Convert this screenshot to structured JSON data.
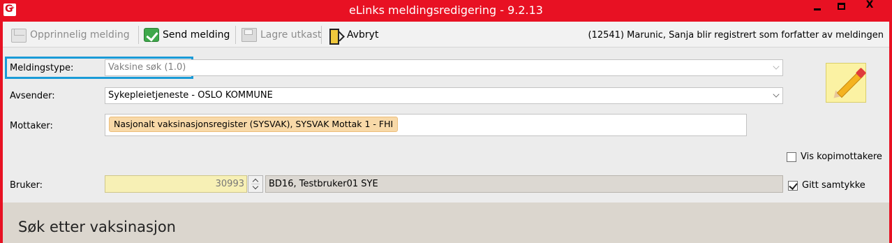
{
  "window": {
    "title": "eLinks meldingsredigering - 9.2.13",
    "app_icon_letter": "G",
    "app_icon_sup": "+",
    "close_glyph": "X"
  },
  "toolbar": {
    "original_label": "Opprinnelig melding",
    "send_label": "Send melding",
    "save_draft_label": "Lagre utkast",
    "cancel_label": "Avbryt",
    "info_text": "(12541) Marunic, Sanja blir registrert som forfatter av meldingen"
  },
  "form": {
    "message_type_label": "Meldingstype:",
    "message_type_value": "Vaksine søk (1.0)",
    "sender_label": "Avsender:",
    "sender_value": "Sykepleietjeneste - OSLO KOMMUNE",
    "recipient_label": "Mottaker:",
    "recipient_chip": "Nasjonalt vaksinasjonsregister (SYSVAK), SYSVAK Mottak 1 - FHI",
    "show_cc_label": "Vis kopimottakere",
    "show_cc_checked": false,
    "user_label": "Bruker:",
    "user_number": "30993",
    "user_name": "BD16, Testbruker01 SYE",
    "consent_label": "Gitt samtykke",
    "consent_checked": true
  },
  "section": {
    "title": "Søk etter vaksinasjon"
  },
  "colors": {
    "window_frame": "#e81123",
    "highlight_box": "#1a9bd7",
    "chip_background": "#f8d9a8",
    "user_number_background": "#f7f0b5"
  },
  "icons": {
    "original": "mail-icon",
    "send": "check-icon",
    "save": "floppy-disk-icon",
    "cancel": "exit-door-icon",
    "edit": "pencil-icon"
  }
}
